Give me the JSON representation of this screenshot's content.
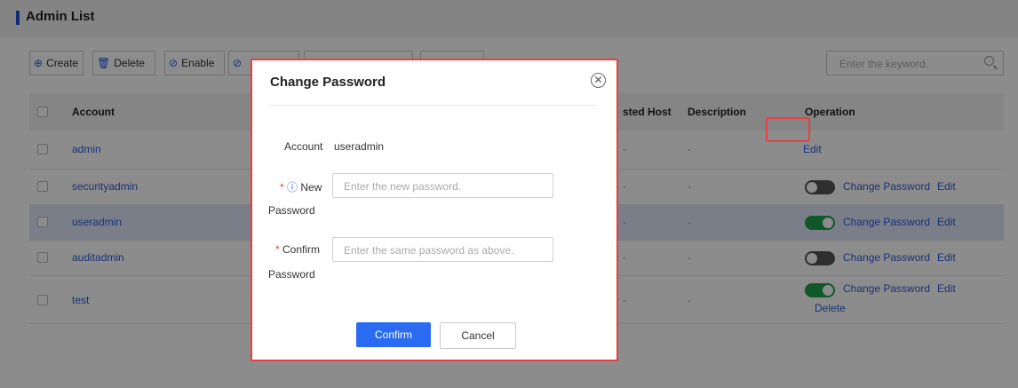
{
  "page": {
    "title": "Admin List"
  },
  "toolbar": {
    "create_label": "Create",
    "delete_label": "Delete",
    "enable_label": "Enable",
    "disable_label": ""
  },
  "search": {
    "placeholder": "Enter the keyword."
  },
  "table": {
    "headers": {
      "account": "Account",
      "trusted_host": "sted Host",
      "description": "Description",
      "operation": "Operation"
    },
    "rows": [
      {
        "account": "admin",
        "trusted_host": "-",
        "description": "-",
        "toggle": "none",
        "links": [
          "Edit"
        ]
      },
      {
        "account": "securityadmin",
        "trusted_host": "-",
        "description": "-",
        "toggle": "off",
        "links": [
          "Change Password",
          "Edit"
        ]
      },
      {
        "account": "useradmin",
        "trusted_host": "-",
        "description": "-",
        "toggle": "on",
        "links": [
          "Change Password",
          "Edit"
        ],
        "selected": true
      },
      {
        "account": "auditadmin",
        "trusted_host": "-",
        "description": "-",
        "toggle": "off",
        "links": [
          "Change Password",
          "Edit"
        ]
      },
      {
        "account": "test",
        "trusted_host": "-",
        "description": "-",
        "toggle": "on",
        "links": [
          "Change Password",
          "Edit",
          "Delete"
        ]
      }
    ]
  },
  "modal": {
    "title": "Change Password",
    "account_label": "Account",
    "account_value": "useradmin",
    "new_password": {
      "required_mark": "*",
      "info_icon": "ⓘ",
      "label_line1": "New",
      "label_line2": "Password",
      "placeholder": "Enter the new password."
    },
    "confirm_password": {
      "required_mark": "*",
      "label_line1": "Confirm",
      "label_line2": "Password",
      "placeholder": "Enter the same password as above."
    },
    "confirm_button": "Confirm",
    "cancel_button": "Cancel"
  },
  "colors": {
    "accent": "#2a6bf2",
    "link": "#2a5bd7",
    "toggle_on": "#1fa04a",
    "highlight": "#e84040"
  }
}
